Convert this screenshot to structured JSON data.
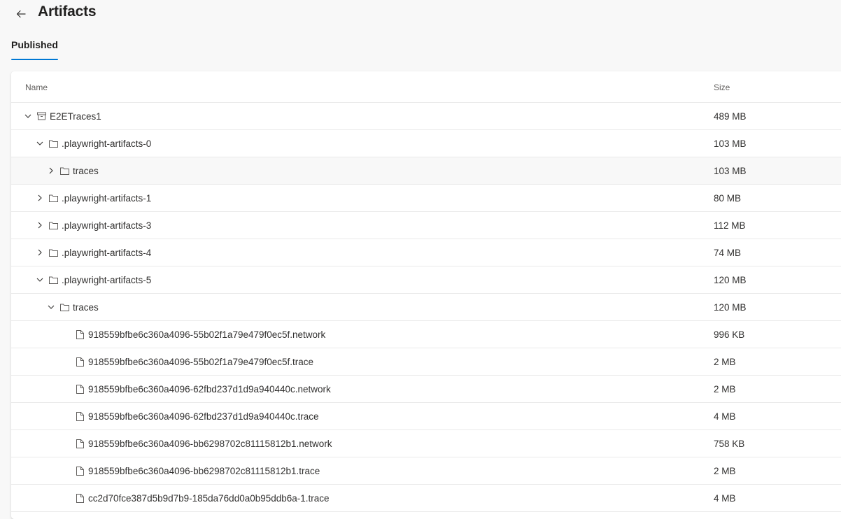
{
  "header": {
    "title": "Artifacts"
  },
  "tabs": [
    {
      "label": "Published"
    }
  ],
  "table": {
    "columns": {
      "name": "Name",
      "size": "Size"
    },
    "rows": [
      {
        "name": "E2ETraces1",
        "size": "489 MB",
        "icon": "archive-icon",
        "chevron": "expanded"
      },
      {
        "name": ".playwright-artifacts-0",
        "size": "103 MB",
        "icon": "folder-icon",
        "chevron": "expanded"
      },
      {
        "name": "traces",
        "size": "103 MB",
        "icon": "folder-icon",
        "chevron": "collapsed"
      },
      {
        "name": ".playwright-artifacts-1",
        "size": "80 MB",
        "icon": "folder-icon",
        "chevron": "collapsed"
      },
      {
        "name": ".playwright-artifacts-3",
        "size": "112 MB",
        "icon": "folder-icon",
        "chevron": "collapsed"
      },
      {
        "name": ".playwright-artifacts-4",
        "size": "74 MB",
        "icon": "folder-icon",
        "chevron": "collapsed"
      },
      {
        "name": ".playwright-artifacts-5",
        "size": "120 MB",
        "icon": "folder-icon",
        "chevron": "expanded"
      },
      {
        "name": "traces",
        "size": "120 MB",
        "icon": "folder-icon",
        "chevron": "expanded"
      },
      {
        "name": "918559bfbe6c360a4096-55b02f1a79e479f0ec5f.network",
        "size": "996 KB",
        "icon": "file-icon"
      },
      {
        "name": "918559bfbe6c360a4096-55b02f1a79e479f0ec5f.trace",
        "size": "2 MB",
        "icon": "file-icon"
      },
      {
        "name": "918559bfbe6c360a4096-62fbd237d1d9a940440c.network",
        "size": "2 MB",
        "icon": "file-icon"
      },
      {
        "name": "918559bfbe6c360a4096-62fbd237d1d9a940440c.trace",
        "size": "4 MB",
        "icon": "file-icon"
      },
      {
        "name": "918559bfbe6c360a4096-bb6298702c81115812b1.network",
        "size": "758 KB",
        "icon": "file-icon"
      },
      {
        "name": "918559bfbe6c360a4096-bb6298702c81115812b1.trace",
        "size": "2 MB",
        "icon": "file-icon"
      },
      {
        "name": "cc2d70fce387d5b9d7b9-185da76dd0a0b95ddb6a-1.trace",
        "size": "4 MB",
        "icon": "file-icon"
      }
    ]
  },
  "colors": {
    "accent": "#0078d4",
    "text": "#323130",
    "muted": "#605e5c",
    "divider": "#eaeaea"
  }
}
